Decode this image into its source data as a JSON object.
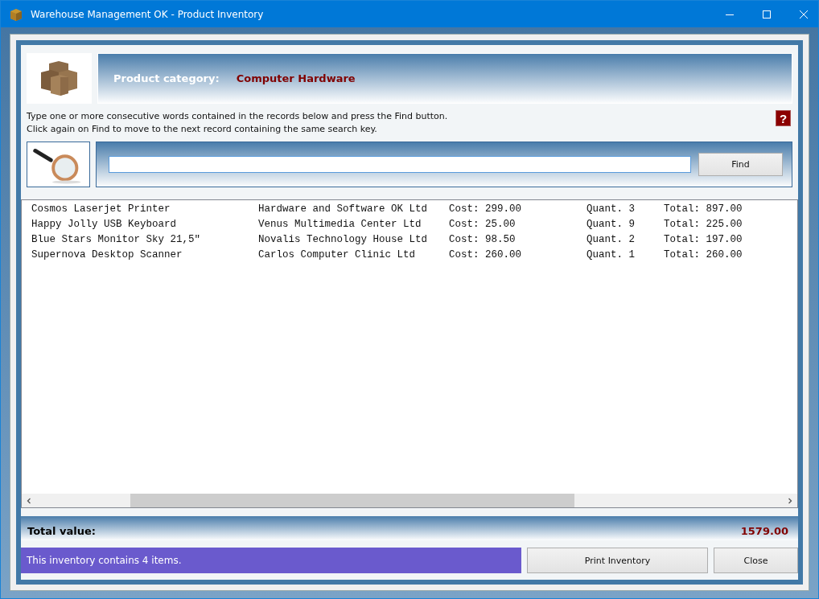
{
  "window": {
    "title": "Warehouse Management OK - Product Inventory"
  },
  "category": {
    "label": "Product category:",
    "value": "Computer Hardware"
  },
  "instructions": [
    "Type one or more consecutive words contained in the records below and press the Find button.",
    "Click again on Find to move to the next record containing the same search key."
  ],
  "help_button": "?",
  "search": {
    "find_button": "Find"
  },
  "records": [
    {
      "name": "Cosmos Laserjet Printer",
      "supplier": "Hardware and Software OK Ltd",
      "cost": "Cost: 299.00",
      "quantity": "Quant. 3",
      "total": "Total: 897.00"
    },
    {
      "name": "Happy Jolly USB Keyboard",
      "supplier": "Venus Multimedia Center Ltd",
      "cost": "Cost: 25.00",
      "quantity": "Quant. 9",
      "total": "Total: 225.00"
    },
    {
      "name": "Blue Stars Monitor Sky 21,5\"",
      "supplier": "Novalis Technology House Ltd",
      "cost": "Cost: 98.50",
      "quantity": "Quant. 2",
      "total": "Total: 197.00"
    },
    {
      "name": "Supernova Desktop Scanner",
      "supplier": "Carlos Computer Clinic Ltd",
      "cost": "Cost: 260.00",
      "quantity": "Quant. 1",
      "total": "Total: 260.00"
    }
  ],
  "total": {
    "label": "Total value:",
    "value": "1579.00"
  },
  "status": "This inventory contains 4 items.",
  "buttons": [
    "Print Inventory",
    "Close"
  ]
}
